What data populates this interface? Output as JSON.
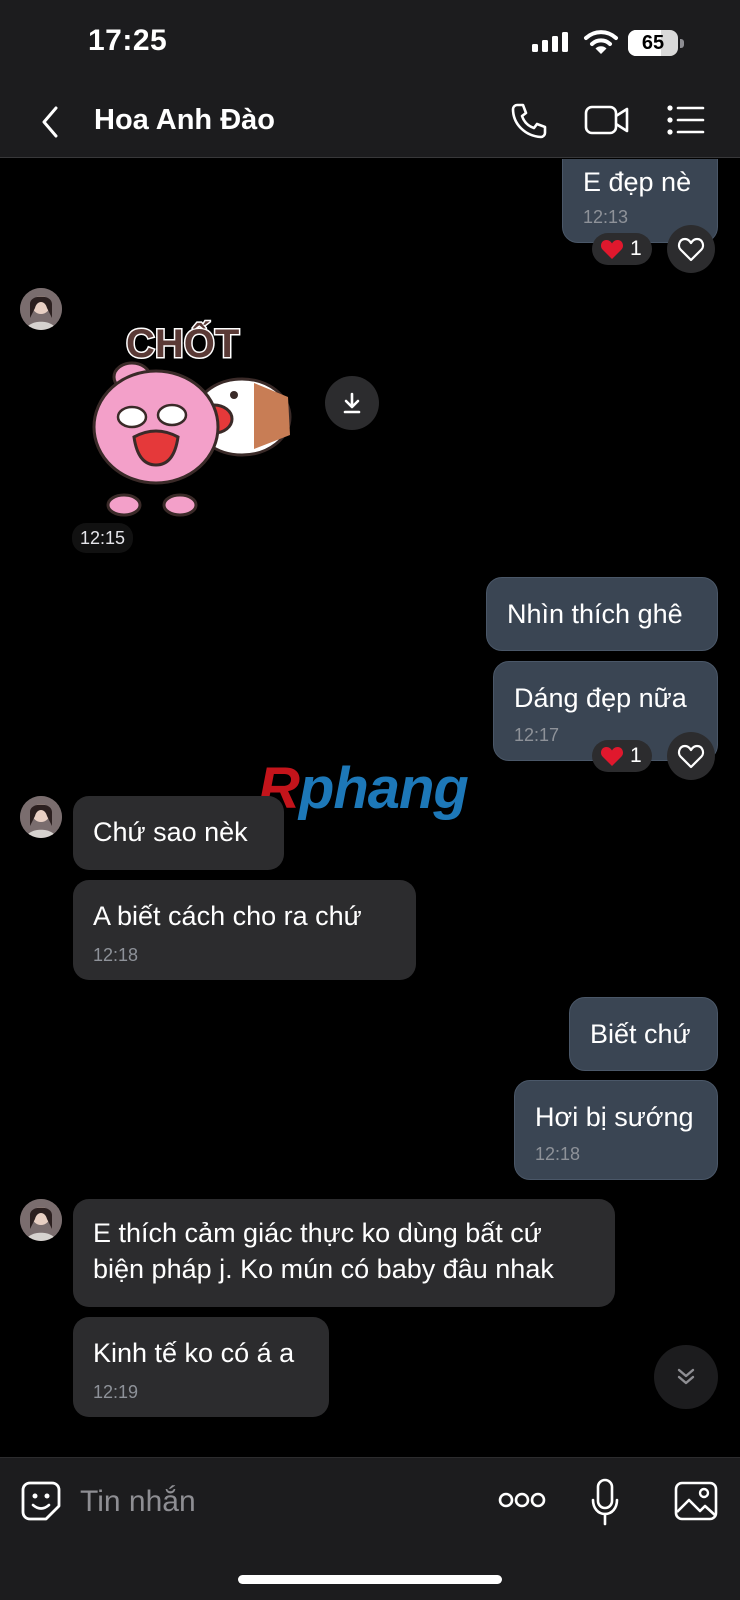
{
  "status_bar": {
    "time": "17:25",
    "battery": "65",
    "battery_level": 0.65
  },
  "header": {
    "contact_name": "Hoa Anh Đào",
    "icons": [
      "back-icon",
      "phone-icon",
      "video-call-icon",
      "menu-icon"
    ]
  },
  "messages": [
    {
      "direction": "outgoing",
      "text": "E đẹp nè",
      "time": "12:13",
      "reaction": {
        "emoji": "heart",
        "count": "1"
      }
    },
    {
      "direction": "incoming",
      "type": "sticker",
      "sticker_text": "CHỐT",
      "time": "12:15"
    },
    {
      "direction": "outgoing",
      "text": "Nhìn thích ghê"
    },
    {
      "direction": "outgoing",
      "text": "Dáng đẹp nữa",
      "time": "12:17",
      "reaction": {
        "emoji": "heart",
        "count": "1"
      }
    },
    {
      "direction": "incoming",
      "text": "Chứ sao nèk"
    },
    {
      "direction": "incoming",
      "text": "A biết cách cho ra chứ",
      "time": "12:18"
    },
    {
      "direction": "outgoing",
      "text": "Biết chứ"
    },
    {
      "direction": "outgoing",
      "text": "Hơi bị sướng",
      "time": "12:18"
    },
    {
      "direction": "incoming",
      "lines": [
        "E thích cảm giác thực ko dùng bất cứ",
        "biện pháp j. Ko mún có baby đâu nhak"
      ]
    },
    {
      "direction": "incoming",
      "text": "Kinh tế ko có á a",
      "time": "12:19"
    }
  ],
  "watermark": {
    "part1": "R",
    "part2": "phang"
  },
  "composer": {
    "placeholder": "Tin nhắn"
  },
  "colors": {
    "background": "#000000",
    "bar": "#1c1c1e",
    "outgoing_bubble": "#3a4553",
    "incoming_bubble": "#2c2c2e",
    "timestamp": "#8e9299",
    "heart": "#e0182d"
  }
}
